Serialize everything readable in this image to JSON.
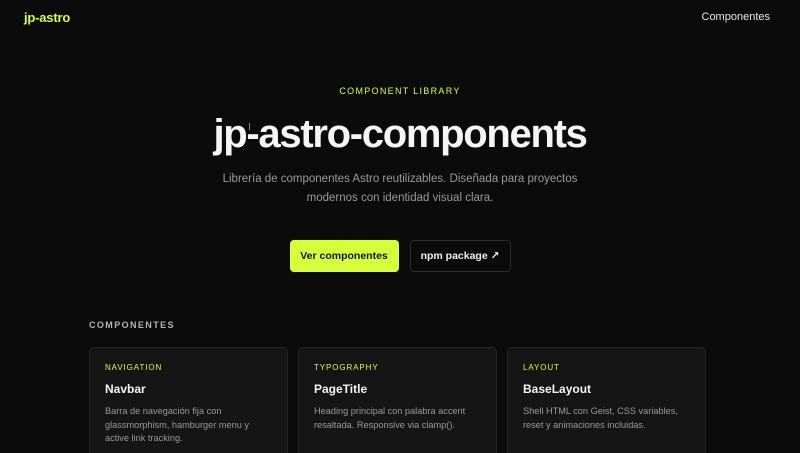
{
  "nav": {
    "brand": "jp-astro",
    "link": "Componentes"
  },
  "hero": {
    "eyebrow": "COMPONENT LIBRARY",
    "title": "jp-astro-components",
    "subtitle": "Librería de componentes Astro reutilizables. Diseñada para proyectos modernos con identidad visual clara.",
    "primary_button": "Ver componentes",
    "secondary_button": "npm package ↗"
  },
  "components": {
    "heading": "COMPONENTES",
    "cards": [
      {
        "tag": "NAVIGATION",
        "title": "Navbar",
        "desc": "Barra de navegación fija con glassmorphism, hamburger menu y active link tracking."
      },
      {
        "tag": "TYPOGRAPHY",
        "title": "PageTitle",
        "desc": "Heading principal con palabra accent resaltada. Responsive via clamp()."
      },
      {
        "tag": "LAYOUT",
        "title": "BaseLayout",
        "desc": "Shell HTML con Geist, CSS variables, reset y animaciones incluidas."
      }
    ]
  },
  "colors": {
    "accent": "#d6ff3a",
    "background": "#0b0b0b",
    "card": "#151515"
  }
}
